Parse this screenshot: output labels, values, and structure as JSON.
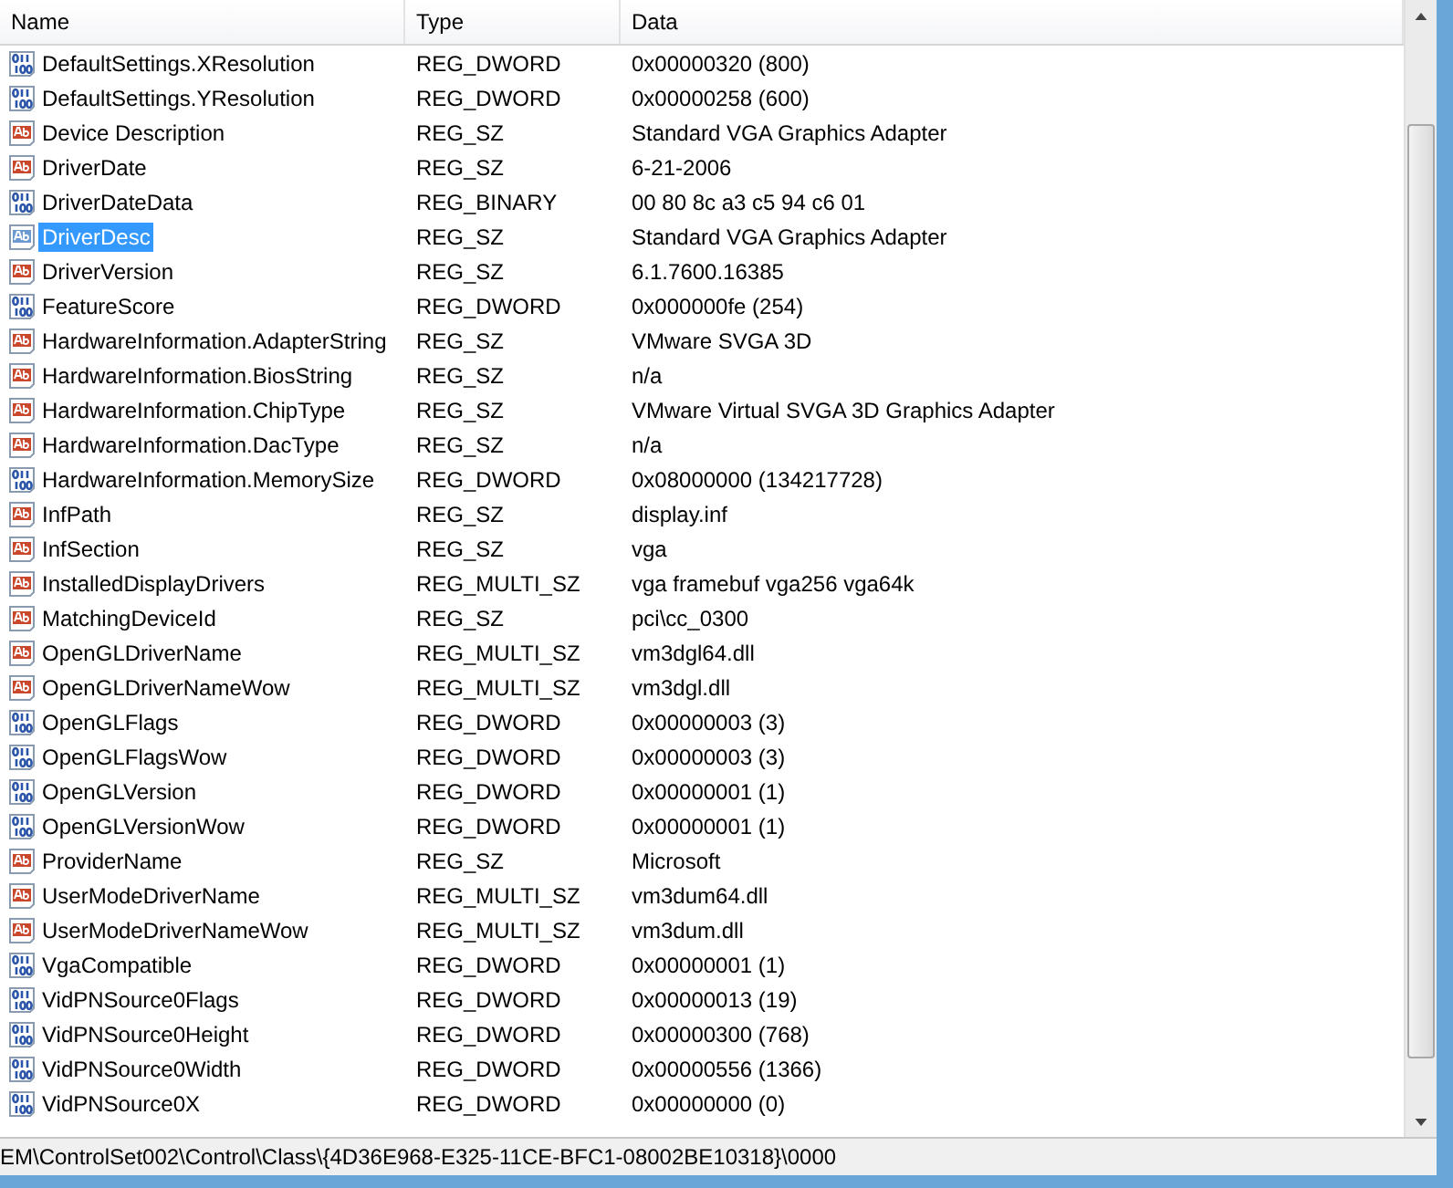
{
  "columns": [
    {
      "label": "Name"
    },
    {
      "label": "Type"
    },
    {
      "label": "Data"
    }
  ],
  "rows": [
    {
      "kind": "bin",
      "name": "DefaultSettings.XResolution",
      "type": "REG_DWORD",
      "data": "0x00000320 (800)",
      "selected": false
    },
    {
      "kind": "bin",
      "name": "DefaultSettings.YResolution",
      "type": "REG_DWORD",
      "data": "0x00000258 (600)",
      "selected": false
    },
    {
      "kind": "sz",
      "name": "Device Description",
      "type": "REG_SZ",
      "data": "Standard VGA Graphics Adapter",
      "selected": false
    },
    {
      "kind": "sz",
      "name": "DriverDate",
      "type": "REG_SZ",
      "data": "6-21-2006",
      "selected": false
    },
    {
      "kind": "bin",
      "name": "DriverDateData",
      "type": "REG_BINARY",
      "data": "00 80 8c a3 c5 94 c6 01",
      "selected": false
    },
    {
      "kind": "sz",
      "name": "DriverDesc",
      "type": "REG_SZ",
      "data": "Standard VGA Graphics Adapter",
      "selected": true
    },
    {
      "kind": "sz",
      "name": "DriverVersion",
      "type": "REG_SZ",
      "data": "6.1.7600.16385",
      "selected": false
    },
    {
      "kind": "bin",
      "name": "FeatureScore",
      "type": "REG_DWORD",
      "data": "0x000000fe (254)",
      "selected": false
    },
    {
      "kind": "sz",
      "name": "HardwareInformation.AdapterString",
      "type": "REG_SZ",
      "data": "VMware SVGA 3D",
      "selected": false
    },
    {
      "kind": "sz",
      "name": "HardwareInformation.BiosString",
      "type": "REG_SZ",
      "data": "n/a",
      "selected": false
    },
    {
      "kind": "sz",
      "name": "HardwareInformation.ChipType",
      "type": "REG_SZ",
      "data": "VMware Virtual SVGA 3D Graphics Adapter",
      "selected": false
    },
    {
      "kind": "sz",
      "name": "HardwareInformation.DacType",
      "type": "REG_SZ",
      "data": "n/a",
      "selected": false
    },
    {
      "kind": "bin",
      "name": "HardwareInformation.MemorySize",
      "type": "REG_DWORD",
      "data": "0x08000000 (134217728)",
      "selected": false
    },
    {
      "kind": "sz",
      "name": "InfPath",
      "type": "REG_SZ",
      "data": "display.inf",
      "selected": false
    },
    {
      "kind": "sz",
      "name": "InfSection",
      "type": "REG_SZ",
      "data": "vga",
      "selected": false
    },
    {
      "kind": "sz",
      "name": "InstalledDisplayDrivers",
      "type": "REG_MULTI_SZ",
      "data": "vga framebuf vga256 vga64k",
      "selected": false
    },
    {
      "kind": "sz",
      "name": "MatchingDeviceId",
      "type": "REG_SZ",
      "data": "pci\\cc_0300",
      "selected": false
    },
    {
      "kind": "sz",
      "name": "OpenGLDriverName",
      "type": "REG_MULTI_SZ",
      "data": "vm3dgl64.dll",
      "selected": false
    },
    {
      "kind": "sz",
      "name": "OpenGLDriverNameWow",
      "type": "REG_MULTI_SZ",
      "data": "vm3dgl.dll",
      "selected": false
    },
    {
      "kind": "bin",
      "name": "OpenGLFlags",
      "type": "REG_DWORD",
      "data": "0x00000003 (3)",
      "selected": false
    },
    {
      "kind": "bin",
      "name": "OpenGLFlagsWow",
      "type": "REG_DWORD",
      "data": "0x00000003 (3)",
      "selected": false
    },
    {
      "kind": "bin",
      "name": "OpenGLVersion",
      "type": "REG_DWORD",
      "data": "0x00000001 (1)",
      "selected": false
    },
    {
      "kind": "bin",
      "name": "OpenGLVersionWow",
      "type": "REG_DWORD",
      "data": "0x00000001 (1)",
      "selected": false
    },
    {
      "kind": "sz",
      "name": "ProviderName",
      "type": "REG_SZ",
      "data": "Microsoft",
      "selected": false
    },
    {
      "kind": "sz",
      "name": "UserModeDriverName",
      "type": "REG_MULTI_SZ",
      "data": "vm3dum64.dll",
      "selected": false
    },
    {
      "kind": "sz",
      "name": "UserModeDriverNameWow",
      "type": "REG_MULTI_SZ",
      "data": "vm3dum.dll",
      "selected": false
    },
    {
      "kind": "bin",
      "name": "VgaCompatible",
      "type": "REG_DWORD",
      "data": "0x00000001 (1)",
      "selected": false
    },
    {
      "kind": "bin",
      "name": "VidPNSource0Flags",
      "type": "REG_DWORD",
      "data": "0x00000013 (19)",
      "selected": false
    },
    {
      "kind": "bin",
      "name": "VidPNSource0Height",
      "type": "REG_DWORD",
      "data": "0x00000300 (768)",
      "selected": false
    },
    {
      "kind": "bin",
      "name": "VidPNSource0Width",
      "type": "REG_DWORD",
      "data": "0x00000556 (1366)",
      "selected": false
    },
    {
      "kind": "bin",
      "name": "VidPNSource0X",
      "type": "REG_DWORD",
      "data": "0x00000000 (0)",
      "selected": false
    }
  ],
  "status_bar": {
    "path": "EM\\ControlSet002\\Control\\Class\\{4D36E968-E325-11CE-BFC1-08002BE10318}\\0000"
  }
}
